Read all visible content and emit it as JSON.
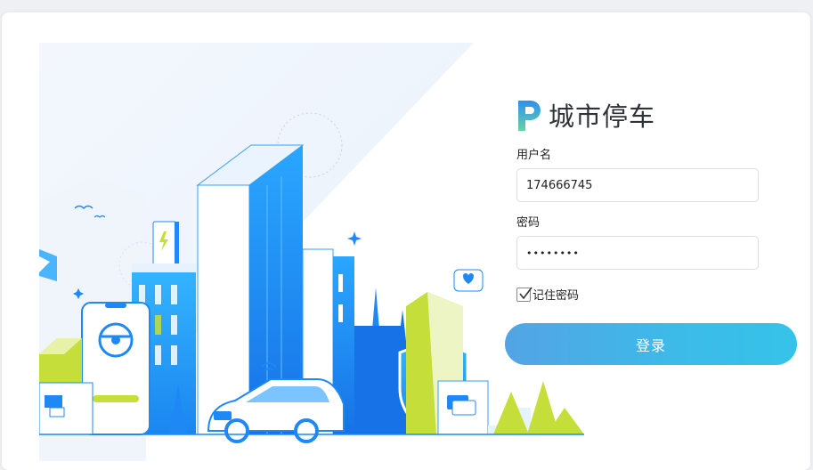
{
  "brand": {
    "name": "城市停车",
    "logo_icon": "parking-p-logo-icon"
  },
  "form": {
    "username_label": "用户名",
    "username_value": "174666745",
    "password_label": "密码",
    "password_value": "••••••••",
    "remember_label": "记住密码",
    "remember_checked": true,
    "login_label": "登录"
  },
  "colors": {
    "accent": "#3cbbe9",
    "brand_text": "#2f3338",
    "illustration_blue": "#1e88f5",
    "illustration_green": "#c5de3a"
  }
}
